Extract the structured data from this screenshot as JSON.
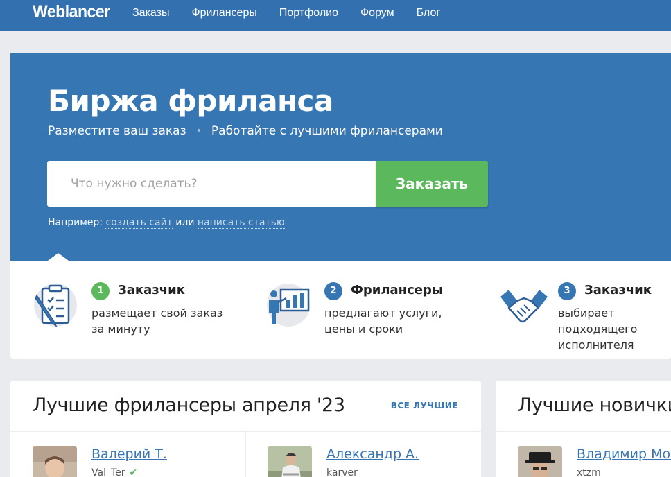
{
  "header": {
    "logo": "Weblancer",
    "nav": [
      "Заказы",
      "Фрилансеры",
      "Портфолио",
      "Форум",
      "Блог"
    ]
  },
  "hero": {
    "title": "Биржа фриланса",
    "sub_left": "Разместите ваш заказ",
    "sub_sep": "•",
    "sub_right": "Работайте с лучшими фрилансерами",
    "search_placeholder": "Что нужно сделать?",
    "order_button": "Заказать",
    "example_prefix": "Например:",
    "example_link1": "создать сайт",
    "example_or": "или",
    "example_link2": "написать статью"
  },
  "steps": [
    {
      "num": "1",
      "title": "Заказчик",
      "desc": "размещает свой заказ за минуту",
      "color": "#5cb85c"
    },
    {
      "num": "2",
      "title": "Фрилансеры",
      "desc": "предлагают услуги, цены и сроки",
      "color": "#3676b3"
    },
    {
      "num": "3",
      "title": "Заказчик",
      "desc": "выбирает подходящего исполнителя",
      "color": "#3676b3"
    }
  ],
  "best": {
    "title": "Лучшие фрилансеры апреля '23",
    "link": "ВСЕ ЛУЧШИЕ",
    "people": [
      {
        "name": "Валерий Т.",
        "login": "Val_Ter",
        "verified": "✔"
      },
      {
        "name": "Александр А.",
        "login": "karver"
      }
    ]
  },
  "newbies": {
    "title": "Лучшие новички",
    "people": [
      {
        "name": "Владимир Мок",
        "login": "xtzm"
      }
    ]
  }
}
